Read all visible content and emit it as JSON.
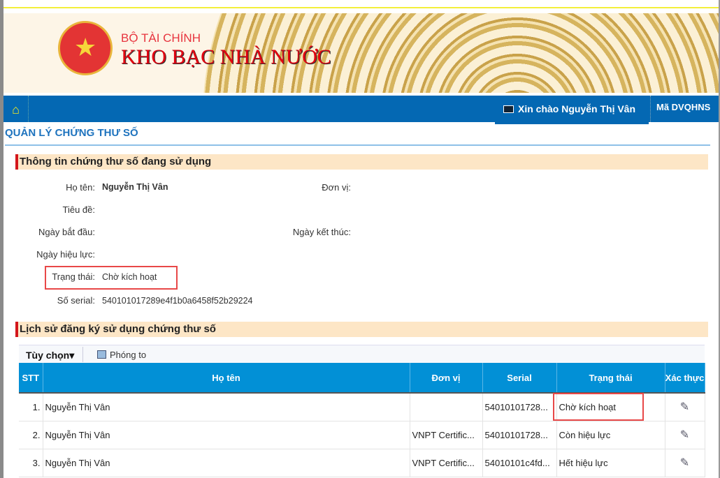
{
  "header": {
    "ministry": "BỘ TÀI CHÍNH",
    "agency": "KHO BẠC NHÀ NƯỚC",
    "greeting": "Xin chào Nguyễn Thị Vân",
    "unit_code_label": "Mã DVQHNS"
  },
  "page_title": "QUẢN LÝ CHỨNG THƯ SỐ",
  "current": {
    "section_title": "Thông tin chứng thư số đang sử dụng",
    "labels": {
      "name": "Họ tên:",
      "unit": "Đơn vị:",
      "subject": "Tiêu đề:",
      "start": "Ngày bắt đầu:",
      "end": "Ngày kết thúc:",
      "effective": "Ngày hiệu lực:",
      "status": "Trạng thái:",
      "serial": "Số serial:"
    },
    "values": {
      "name": "Nguyễn Thị Vân",
      "status": "Chờ kích hoạt",
      "serial": "540101017289e4f1b0a6458f52b29224"
    }
  },
  "history": {
    "section_title": "Lịch sử đăng ký sử dụng chứng thư số",
    "options_label": "Tùy chọn▾",
    "zoom_label": "Phóng to",
    "columns": [
      "STT",
      "Họ tên",
      "Đơn vị",
      "Serial",
      "Trạng thái",
      "Xác thực"
    ],
    "rows": [
      {
        "stt": "1.",
        "name": "Nguyễn Thị Vân",
        "unit": "",
        "serial": "54010101728...",
        "status": "Chờ kích hoạt"
      },
      {
        "stt": "2.",
        "name": "Nguyễn Thị Vân",
        "unit": "VNPT Certific...",
        "serial": "54010101728...",
        "status": "Còn hiệu lực"
      },
      {
        "stt": "3.",
        "name": "Nguyễn Thị Vân",
        "unit": "VNPT Certific...",
        "serial": "54010101c4fd...",
        "status": "Hết hiệu lực"
      }
    ]
  }
}
